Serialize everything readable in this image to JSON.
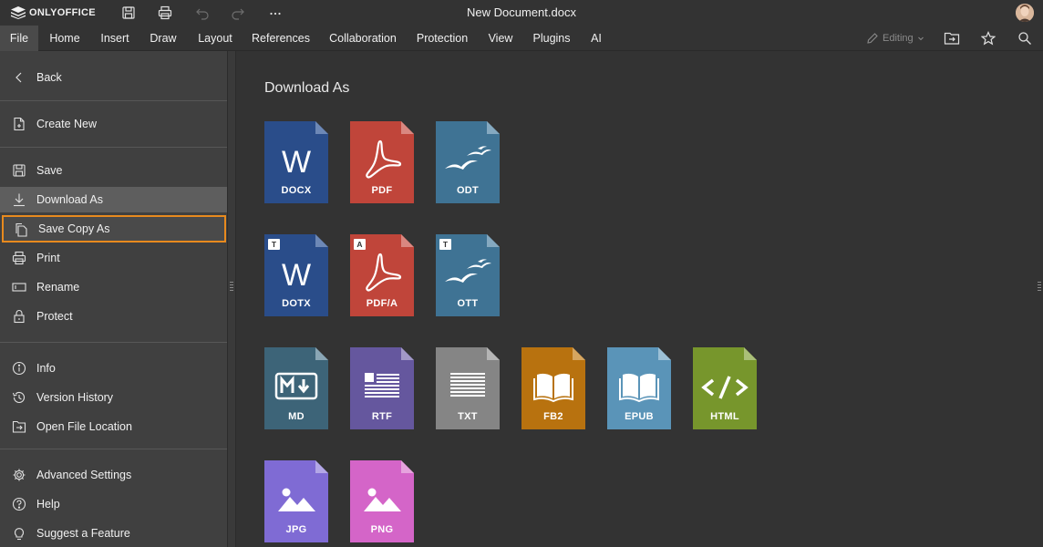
{
  "app": {
    "brand": "ONLYOFFICE",
    "document_title": "New Document.docx"
  },
  "colors": {
    "accent_highlight": "#e88a1e",
    "docx": "#2a4d8a",
    "pdf": "#c0453a",
    "odt": "#3f7394",
    "md": "#3d6478",
    "rtf": "#65579e",
    "txt": "#858585",
    "fb2": "#b8720f",
    "epub": "#5a94b8",
    "html": "#77962c",
    "jpg": "#7f6bd4",
    "png": "#d465c8"
  },
  "menu": {
    "tabs": [
      {
        "label": "File",
        "active": true
      },
      {
        "label": "Home"
      },
      {
        "label": "Insert"
      },
      {
        "label": "Draw"
      },
      {
        "label": "Layout"
      },
      {
        "label": "References"
      },
      {
        "label": "Collaboration"
      },
      {
        "label": "Protection"
      },
      {
        "label": "View"
      },
      {
        "label": "Plugins"
      },
      {
        "label": "AI"
      }
    ],
    "editing_label": "Editing"
  },
  "sidebar": {
    "items": [
      {
        "label": "Back",
        "icon": "chevron-left-icon"
      },
      {
        "label": "Create New",
        "icon": "new-file-icon"
      },
      {
        "label": "Save",
        "icon": "save-icon"
      },
      {
        "label": "Download As",
        "icon": "download-icon",
        "selected": true
      },
      {
        "label": "Save Copy As",
        "icon": "copy-icon",
        "highlighted": true
      },
      {
        "label": "Print",
        "icon": "print-icon"
      },
      {
        "label": "Rename",
        "icon": "rename-icon"
      },
      {
        "label": "Protect",
        "icon": "lock-icon"
      },
      {
        "label": "Info",
        "icon": "info-icon"
      },
      {
        "label": "Version History",
        "icon": "history-icon"
      },
      {
        "label": "Open File Location",
        "icon": "folder-icon"
      },
      {
        "label": "Advanced Settings",
        "icon": "gear-icon"
      },
      {
        "label": "Help",
        "icon": "help-icon"
      },
      {
        "label": "Suggest a Feature",
        "icon": "lightbulb-icon"
      }
    ]
  },
  "main": {
    "title": "Download As",
    "formats": [
      {
        "label": "DOCX",
        "glyph": "W"
      },
      {
        "label": "PDF",
        "glyph": "pdf"
      },
      {
        "label": "ODT",
        "glyph": "gulls"
      },
      {
        "label": "DOTX",
        "glyph": "W",
        "badge": "T"
      },
      {
        "label": "PDF/A",
        "glyph": "pdf",
        "badge": "A"
      },
      {
        "label": "OTT",
        "glyph": "gulls",
        "badge": "T"
      },
      {
        "label": "MD",
        "glyph": "md"
      },
      {
        "label": "RTF",
        "glyph": "rtf"
      },
      {
        "label": "TXT",
        "glyph": "txt"
      },
      {
        "label": "FB2",
        "glyph": "book"
      },
      {
        "label": "EPUB",
        "glyph": "book"
      },
      {
        "label": "HTML",
        "glyph": "</>"
      },
      {
        "label": "JPG",
        "glyph": "image"
      },
      {
        "label": "PNG",
        "glyph": "image"
      }
    ]
  }
}
